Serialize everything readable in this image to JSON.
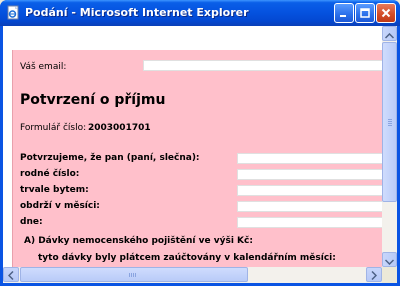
{
  "window": {
    "title": "Podání - Microsoft Internet Explorer"
  },
  "form": {
    "email_label": "Váš email:",
    "email_value": "",
    "heading": "Potvrzení o příjmu",
    "form_number_label": "Formulář číslo:",
    "form_number_value": "2003001701",
    "fields": [
      {
        "label": "Potvrzujeme, že pan (paní, slečna):",
        "value": ""
      },
      {
        "label": "rodné číslo:",
        "value": ""
      },
      {
        "label": "trvale bytem:",
        "value": ""
      },
      {
        "label": "obdrží v měsíci:",
        "value": ""
      },
      {
        "label": "dne:",
        "value": ""
      }
    ],
    "section_a": "A) Dávky nemocenského pojištění ve výši Kč:",
    "section_a_sub": "tyto dávky byly plátcem zaúčtovány v kalendářním měsíci:"
  },
  "colors": {
    "form_background": "#ffc0cb",
    "titlebar": "#0553e0"
  },
  "icons": {
    "app": "ie-page-icon",
    "minimize": "minimize-icon",
    "maximize": "maximize-icon",
    "close": "close-icon"
  }
}
